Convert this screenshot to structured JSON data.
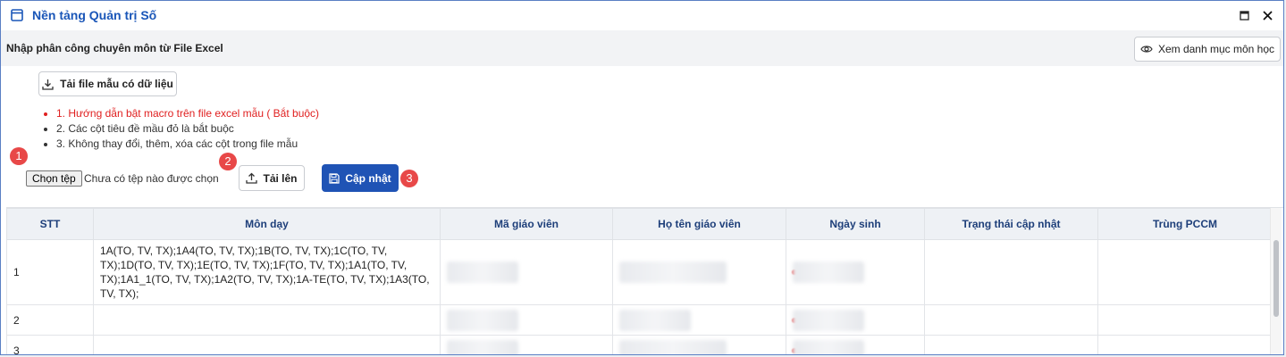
{
  "window": {
    "title": "Nền tảng Quản trị Số"
  },
  "section": {
    "title": "Nhập phân công chuyên môn từ File Excel",
    "view_subjects_label": "Xem danh mục môn học"
  },
  "toolbar": {
    "download_label": "Tải file mẫu có dữ liệu",
    "choose_file_label": "Chọn tệp",
    "no_file_text": "Chưa có tệp nào được chọn",
    "upload_label": "Tải lên",
    "update_label": "Cập nhật"
  },
  "instructions": [
    "1. Hướng dẫn bật macro trên file excel mẫu ( Bắt buộc)",
    "2. Các cột tiêu đề mầu đỏ là bắt buộc",
    "3. Không thay đổi, thêm, xóa các cột trong file mẫu"
  ],
  "badges": [
    "1",
    "2",
    "3"
  ],
  "table": {
    "headers": [
      "STT",
      "Môn dạy",
      "Mã giáo viên",
      "Họ tên giáo viên",
      "Ngày sinh",
      "Trạng thái cập nhật",
      "Trùng PCCM"
    ],
    "rows": [
      {
        "stt": "1",
        "subjects": "1A(TO, TV, TX);1A4(TO, TV, TX);1B(TO, TV, TX);1C(TO, TV, TX);1D(TO, TV, TX);1E(TO, TV, TX);1F(TO, TV, TX);1A1(TO, TV, TX);1A1_1(TO, TV, TX);1A2(TO, TV, TX);1A-TE(TO, TV, TX);1A3(TO, TV, TX);"
      },
      {
        "stt": "2",
        "subjects": ""
      },
      {
        "stt": "3",
        "subjects": ""
      }
    ]
  },
  "colors": {
    "accent": "#1f53b5",
    "title": "#1a56b8",
    "badge": "#e84848",
    "required_text": "#e02020"
  }
}
